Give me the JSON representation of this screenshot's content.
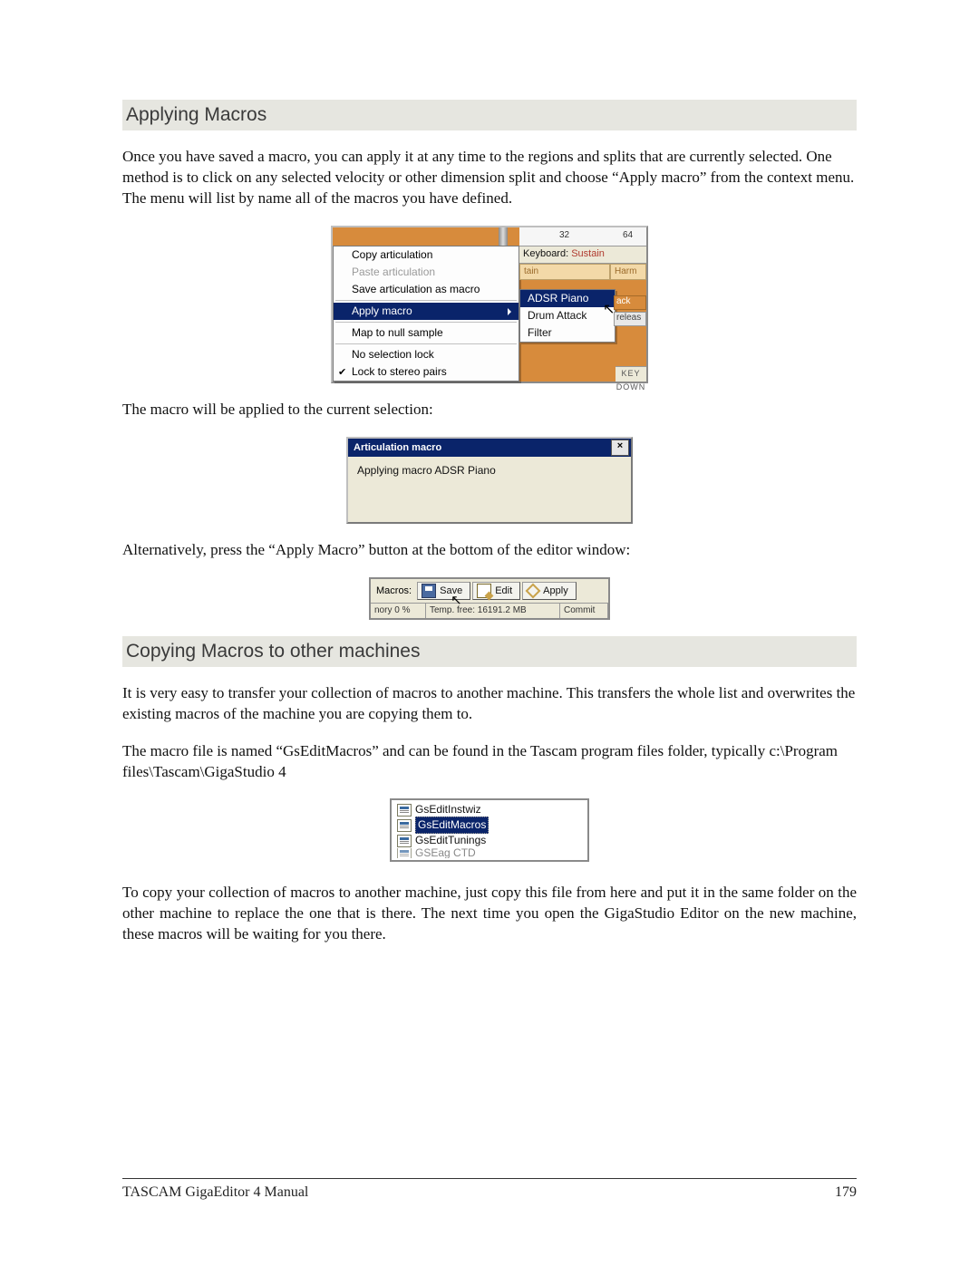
{
  "section1": {
    "heading": "Applying Macros",
    "para1": "Once you have saved a macro, you can apply it at any time to the regions and splits that are currently selected.  One method is to click on any selected velocity or other dimension split and choose “Apply macro” from the context menu.  The menu will list by name all of the macros you have defined.",
    "para2": "The macro will be applied to the current selection:",
    "para3": "Alternatively, press the “Apply Macro” button at the bottom of the editor window:"
  },
  "fig1": {
    "tick32": "32",
    "tick64": "64",
    "keyboard_label": "Keyboard:",
    "sustain_label": "Sustain",
    "harm_label": "Harm",
    "right_strip1": "ack",
    "right_strip2": "releas",
    "keydown_label": "KEY DOWN",
    "menu": {
      "copy": "Copy articulation",
      "paste": "Paste articulation",
      "save_as_macro": "Save articulation as macro",
      "apply_macro": "Apply macro",
      "map_null": "Map to null sample",
      "no_lock": "No selection lock",
      "lock_pairs": "Lock to stereo pairs"
    },
    "submenu": {
      "adsr": "ADSR Piano",
      "drum": "Drum Attack",
      "filter": "Filter"
    }
  },
  "fig2": {
    "title": "Articulation macro",
    "close": "×",
    "body": "Applying macro ADSR Piano"
  },
  "fig3": {
    "label": "Macros:",
    "save": "Save",
    "edit": "Edit",
    "apply": "Apply",
    "status_left": "nory 0 %",
    "status_mid": "Temp. free: 16191.2 MB",
    "status_right": "Commit"
  },
  "section2": {
    "heading": "Copying Macros to other machines",
    "para1": "It is very easy to transfer your collection of macros to another machine.  This transfers the whole list and overwrites the existing macros of the machine you are copying them to.",
    "para2": "The macro file is named “GsEditMacros” and can be found in the Tascam program files folder, typically c:\\Program files\\Tascam\\GigaStudio 4",
    "para3": "To copy your collection of macros to another machine, just copy this file from here and put it in the same folder on the other machine to replace the one that is there.  The next time you open the GigaStudio Editor on the new machine, these macros will be waiting for you there."
  },
  "fig4": {
    "file1": "GsEditInstwiz",
    "file2": "GsEditMacros",
    "file3": "GsEditTunings",
    "file4": "GSEag CTD"
  },
  "footer": {
    "title": "TASCAM GigaEditor 4 Manual",
    "page": "179"
  }
}
